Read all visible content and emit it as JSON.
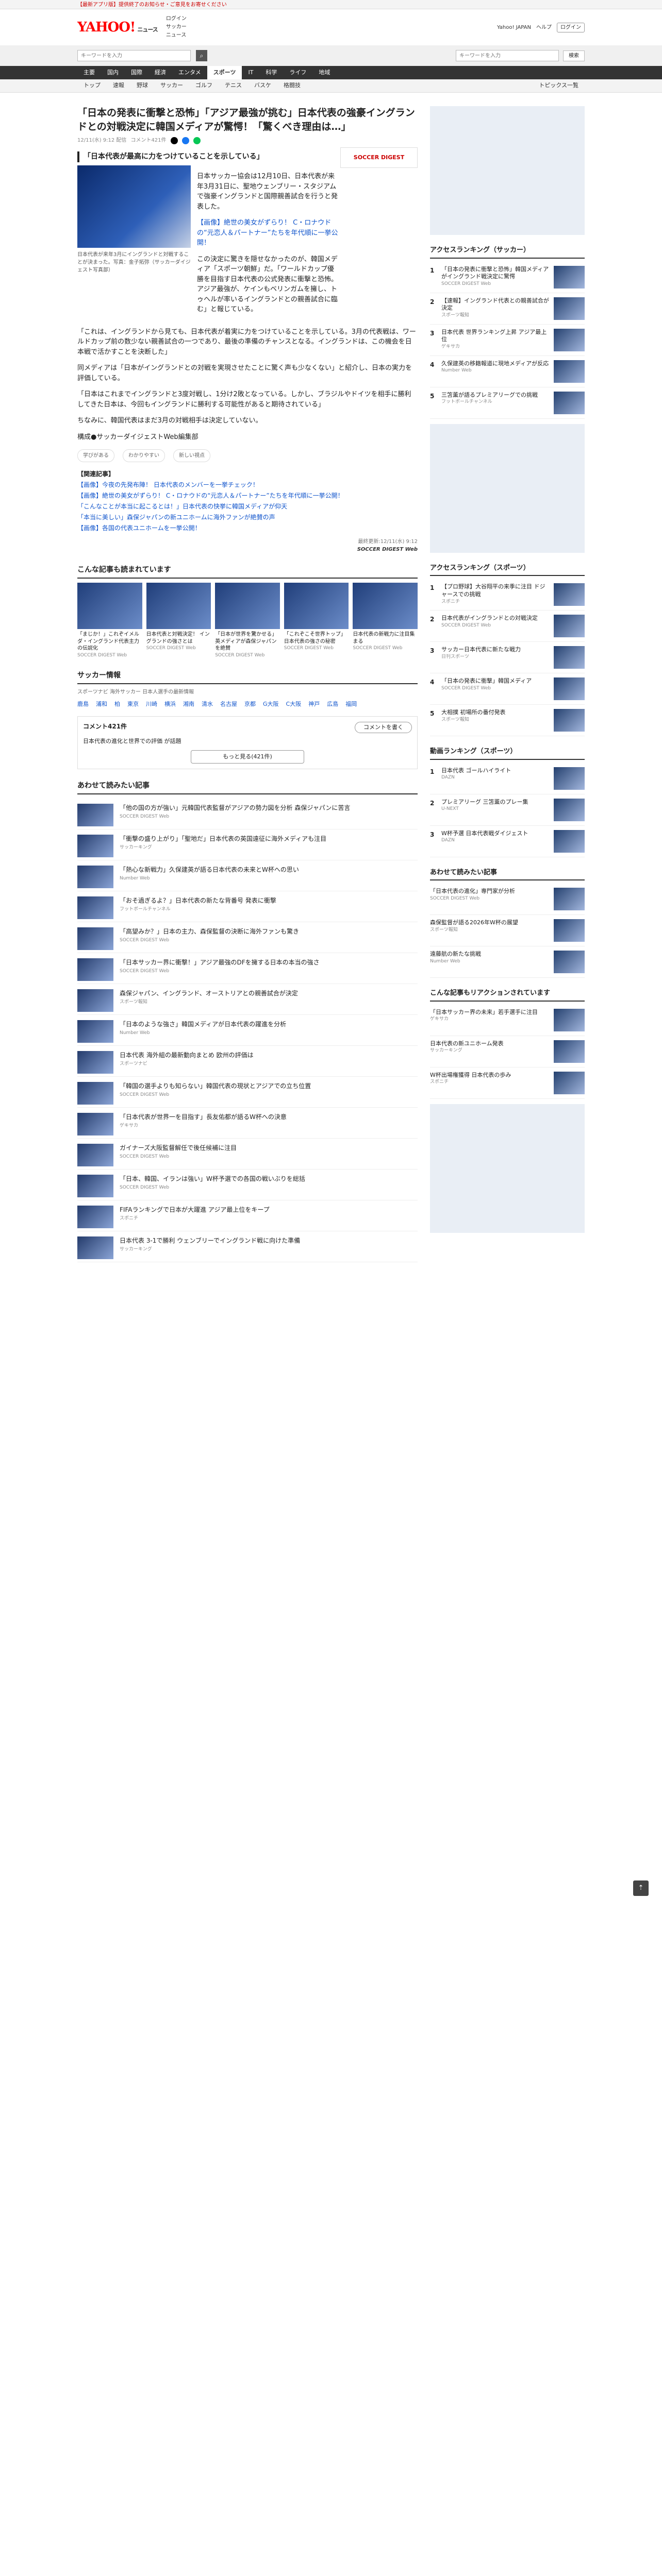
{
  "topbar": {
    "text": "【最新アプリ版】提供終了のお知らせ・ご意見をお寄せください"
  },
  "header": {
    "logo": "YAHOO!",
    "logo_sub": "ニュース",
    "links": [
      "ログイン",
      "サッカー",
      "ニュース"
    ],
    "right": [
      "Yahoo! JAPAN",
      "ヘルプ",
      "ログイン"
    ]
  },
  "search": {
    "placeholder": "キーワードを入力",
    "right_placeholder": "キーワードを入力",
    "go": "検索"
  },
  "nav": [
    "主要",
    "国内",
    "国際",
    "経済",
    "エンタメ",
    "スポーツ",
    "IT",
    "科学",
    "ライフ",
    "地域"
  ],
  "subnav": [
    "トップ",
    "速報",
    "野球",
    "サッカー",
    "ゴルフ",
    "テニス",
    "バスケ",
    "格闘技"
  ],
  "subnav_right": "トピックス一覧",
  "article": {
    "title": "「日本の発表に衝撃と恐怖」「アジア最強が挑む」日本代表の強豪イングランドとの対戦決定に韓国メディアが驚愕！「驚くべき理由は…」",
    "date": "12/11(水) 9:12 配信",
    "comments": "コメント421件",
    "lead": "「日本代表が最高に力をつけていることを示している」",
    "caption": "日本代表が来年3月にイングランドと対戦することが決まった。写真：金子拓弥（サッカーダイジェスト写真部）",
    "intro": "日本サッカー協会は12月10日、日本代表が来年3月31日に、聖地ウェンブリー・スタジアムで強豪イングランドと国際親善試合を行うと発表した。",
    "p1": "【画像】絶世の美女がずらり！ C・ロナウドの“元恋人＆パートナー”たちを年代順に一挙公開！",
    "p2": "この決定に驚きを隠せなかったのが、韓国メディア「スポーツ朝鮮」だ。「ワールドカップ優勝を目指す日本代表の公式発表に衝撃と恐怖。アジア最強が、ケインもベリンガムを擁し、トゥヘルが率いるイングランドとの親善試合に臨む」と報じている。",
    "p3": "「これは、イングランドから見ても、日本代表が着実に力をつけていることを示している。3月の代表戦は、ワールドカップ前の数少ない親善試合の一つであり、最後の準備のチャンスとなる。イングランドは、この機会を日本戦で活かすことを決断した」",
    "p4": "同メディアは「日本がイングランドとの対戦を実現させたことに驚く声も少なくない」と紹介し、日本の実力を評価している。",
    "p5": "「日本はこれまでイングランドと3度対戦し、1分け2敗となっている。しかし、ブラジルやドイツを相手に勝利してきた日本は、今回もイングランドに勝利する可能性があると期待されている」",
    "p6": "ちなみに、韓国代表はまだ3月の対戦相手は決定していない。",
    "editor": "構成●サッカーダイジェストWeb編集部",
    "related_h": "【関連記事】",
    "related": [
      "【画像】今夜の先発布陣！ 日本代表のメンバーを一挙チェック！",
      "【画像】絶世の美女がずらり！ C・ロナウドの“元恋人＆パートナー”たちを年代順に一挙公開！",
      "「こんなことが本当に起こるとは！」日本代表の快挙に韓国メディアが仰天",
      "「本当に美しい」森保ジャパンの新ユニホームに海外ファンが絶賛の声",
      "【画像】各国の代表ユニホームを一挙公開！"
    ],
    "credit": "最終更新:12/11(水) 9:12",
    "credit_src": "SOCCER DIGEST Web",
    "banner": "SOCCER DIGEST",
    "reactions": [
      "学びがある",
      "わかりやすい",
      "新しい視点"
    ]
  },
  "recommend": {
    "heading": "こんな記事も読まれています",
    "items": [
      {
        "title": "「まじか！」これぞイメルダ・イングランド代表主力の伝説化",
        "src": "SOCCER DIGEST Web"
      },
      {
        "title": "日本代表と対戦決定！ イングランドの強さとは",
        "src": "SOCCER DIGEST Web"
      },
      {
        "title": "「日本が世界を驚かせる」英メディアが森保ジャパンを絶賛",
        "src": "SOCCER DIGEST Web"
      },
      {
        "title": "「これぞこそ世界トップ」日本代表の強さの秘密",
        "src": "SOCCER DIGEST Web"
      },
      {
        "title": "日本代表の新戦力に注目集まる",
        "src": "SOCCER DIGEST Web"
      }
    ]
  },
  "soccer": {
    "heading": "サッカー情報",
    "sub": "スポーツナビ 海外サッカー 日本人選手の最新情報",
    "teams": [
      "鹿島",
      "浦和",
      "柏",
      "東京",
      "川崎",
      "横浜",
      "湘南",
      "清水",
      "名古屋",
      "京都",
      "G大阪",
      "C大阪",
      "神戸",
      "広島",
      "福岡"
    ]
  },
  "comment_box": {
    "title": "コメント421件",
    "btn": "コメントを書く",
    "label": "日本代表の進化と世界での評価 が話題",
    "more": "もっと見る(421件)"
  },
  "more_heading": "あわせて読みたい記事",
  "more_items": [
    {
      "title": "「他の国の方が強い」元韓国代表監督がアジアの勢力図を分析 森保ジャパンに苦言",
      "src": "SOCCER DIGEST Web"
    },
    {
      "title": "「衝撃の盛り上がり」「聖地だ」日本代表の英国遠征に海外メディアも注目",
      "src": "サッカーキング"
    },
    {
      "title": "「熱心な新戦力」久保建英が語る日本代表の未来とW杯への思い",
      "src": "Number Web"
    },
    {
      "title": "「おそ過ぎるよ？」日本代表の新たな背番号 発表に衝撃",
      "src": "フットボールチャンネル"
    },
    {
      "title": "「高望みか？」日本の主力、森保監督の決断に海外ファンも驚き",
      "src": "SOCCER DIGEST Web"
    },
    {
      "title": "「日本サッカー界に衝撃！」アジア最強のDFを擁する日本の本当の強さ",
      "src": "SOCCER DIGEST Web"
    },
    {
      "title": "森保ジャパン、イングランド、オーストリアとの親善試合が決定",
      "src": "スポーツ報知"
    },
    {
      "title": "「日本のような強さ」韓国メディアが日本代表の躍進を分析",
      "src": "Number Web"
    },
    {
      "title": "日本代表 海外組の最新動向まとめ 欧州の評価は",
      "src": "スポーツナビ"
    },
    {
      "title": "「韓国の選手よりも知らない」韓国代表の現状とアジアでの立ち位置",
      "src": "SOCCER DIGEST Web"
    },
    {
      "title": "「日本代表が世界一を目指す」長友佑都が語るW杯への決意",
      "src": "ゲキサカ"
    },
    {
      "title": "ガイナーズ大阪監督解任で後任候補に注目",
      "src": "SOCCER DIGEST Web"
    },
    {
      "title": "「日本、韓国、イランは強い」W杯予選での各国の戦いぶりを総括",
      "src": "SOCCER DIGEST Web"
    },
    {
      "title": "FIFAランキングで日本が大躍進 アジア最上位をキープ",
      "src": "スポニチ"
    },
    {
      "title": "日本代表 3-1で勝利 ウェンブリーでイングランド戦に向けた準備",
      "src": "サッカーキング"
    }
  ],
  "sidebar": {
    "access_h": "アクセスランキング（サッカー）",
    "access": [
      {
        "n": "1",
        "t": "「日本の発表に衝撃と恐怖」韓国メディアがイングランド戦決定に驚愕",
        "s": "SOCCER DIGEST Web"
      },
      {
        "n": "2",
        "t": "【速報】イングランド代表との親善試合が決定",
        "s": "スポーツ報知"
      },
      {
        "n": "3",
        "t": "日本代表 世界ランキング上昇 アジア最上位",
        "s": "ゲキサカ"
      },
      {
        "n": "4",
        "t": "久保建英の移籍報道に現地メディアが反応",
        "s": "Number Web"
      },
      {
        "n": "5",
        "t": "三笘薫が語るプレミアリーグでの挑戦",
        "s": "フットボールチャンネル"
      }
    ],
    "sports_h": "アクセスランキング（スポーツ）",
    "sports": [
      {
        "n": "1",
        "t": "【プロ野球】大谷翔平の来季に注目 ドジャースでの挑戦",
        "s": "スポニチ"
      },
      {
        "n": "2",
        "t": "日本代表がイングランドとの対戦決定",
        "s": "SOCCER DIGEST Web"
      },
      {
        "n": "3",
        "t": "サッカー日本代表に新たな戦力",
        "s": "日刊スポーツ"
      },
      {
        "n": "4",
        "t": "「日本の発表に衝撃」韓国メディア",
        "s": "SOCCER DIGEST Web"
      },
      {
        "n": "5",
        "t": "大相撲 初場所の番付発表",
        "s": "スポーツ報知"
      }
    ],
    "video_h": "動画ランキング（スポーツ）",
    "video": [
      {
        "n": "1",
        "t": "日本代表 ゴールハイライト",
        "s": "DAZN"
      },
      {
        "n": "2",
        "t": "プレミアリーグ 三笘薫のプレー集",
        "s": "U-NEXT"
      },
      {
        "n": "3",
        "t": "W杯予選 日本代表戦ダイジェスト",
        "s": "DAZN"
      }
    ],
    "rec_h": "あわせて読みたい記事",
    "rec": [
      {
        "t": "「日本代表の進化」専門家が分析",
        "s": "SOCCER DIGEST Web"
      },
      {
        "t": "森保監督が語る2026年W杯の展望",
        "s": "スポーツ報知"
      },
      {
        "t": "遠藤航の新たな挑戦",
        "s": "Number Web"
      }
    ],
    "react_h": "こんな記事もリアクションされています",
    "react": [
      {
        "t": "「日本サッカー界の未来」若手選手に注目",
        "s": "ゲキサカ"
      },
      {
        "t": "日本代表の新ユニホーム発表",
        "s": "サッカーキング"
      },
      {
        "t": "W杯出場権獲得 日本代表の歩み",
        "s": "スポニチ"
      }
    ]
  }
}
